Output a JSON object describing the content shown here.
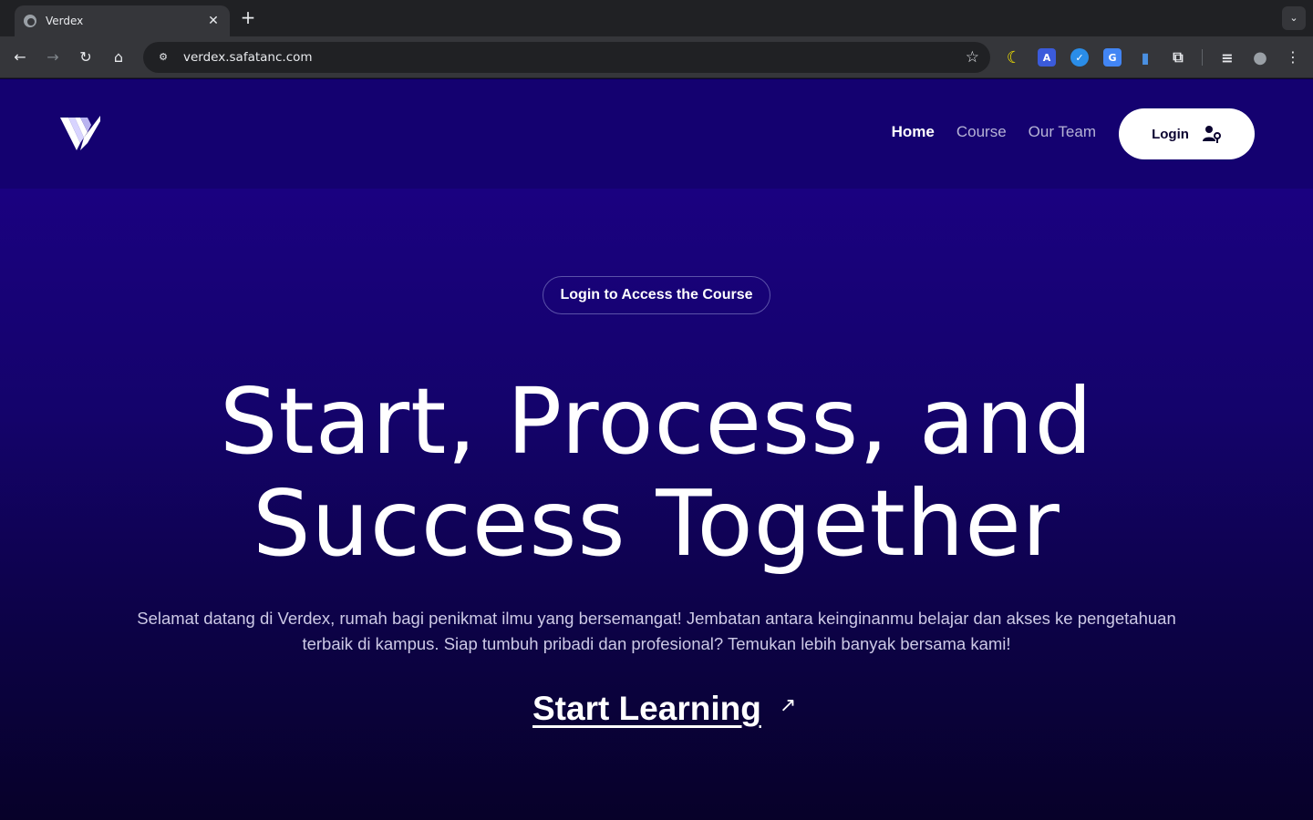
{
  "browser": {
    "tab_title": "Verdex",
    "tab_close": "✕",
    "new_tab": "+",
    "tab_menu": "⌄",
    "url": "verdex.safatanc.com",
    "back": "←",
    "forward": "→",
    "reload": "↻",
    "home": "⌂",
    "star": "☆",
    "site_info": "⚙",
    "menu": "⋮",
    "extensions": [
      {
        "icon": "moon-extension-icon",
        "glyph": "☾",
        "color": "#f5e400"
      },
      {
        "icon": "translate-a-extension-icon",
        "glyph": "A",
        "color": "#3b5bdb"
      },
      {
        "icon": "compass-extension-icon",
        "glyph": "✓",
        "color": "#2a8de8"
      },
      {
        "icon": "google-translate-extension-icon",
        "glyph": "G",
        "color": "#4285f4"
      },
      {
        "icon": "document-extension-icon",
        "glyph": "▮",
        "color": "#4a90e2"
      },
      {
        "icon": "puzzle-extension-icon",
        "glyph": "⧉",
        "color": "#35363a"
      },
      {
        "icon": "media-queue-icon",
        "glyph": "≡",
        "color": "#35363a"
      },
      {
        "icon": "profile-avatar-icon",
        "glyph": "●",
        "color": "#5f6368"
      }
    ]
  },
  "site": {
    "nav": [
      {
        "label": "Home",
        "active": true
      },
      {
        "label": "Course",
        "active": false
      },
      {
        "label": "Our Team",
        "active": false
      }
    ],
    "login_label": "Login",
    "pill_label": "Login to Access the Course",
    "hero_line1": "Start, Process, and",
    "hero_line2": "Success Together",
    "hero_text": "Selamat datang di Verdex, rumah bagi penikmat ilmu yang bersemangat! Jembatan antara keinginanmu belajar dan akses ke pengetahuan terbaik di kampus. Siap tumbuh pribadi dan profesional? Temukan lebih banyak bersama kami!",
    "cta_label": "Start Learning",
    "cta_arrow": "↗"
  }
}
